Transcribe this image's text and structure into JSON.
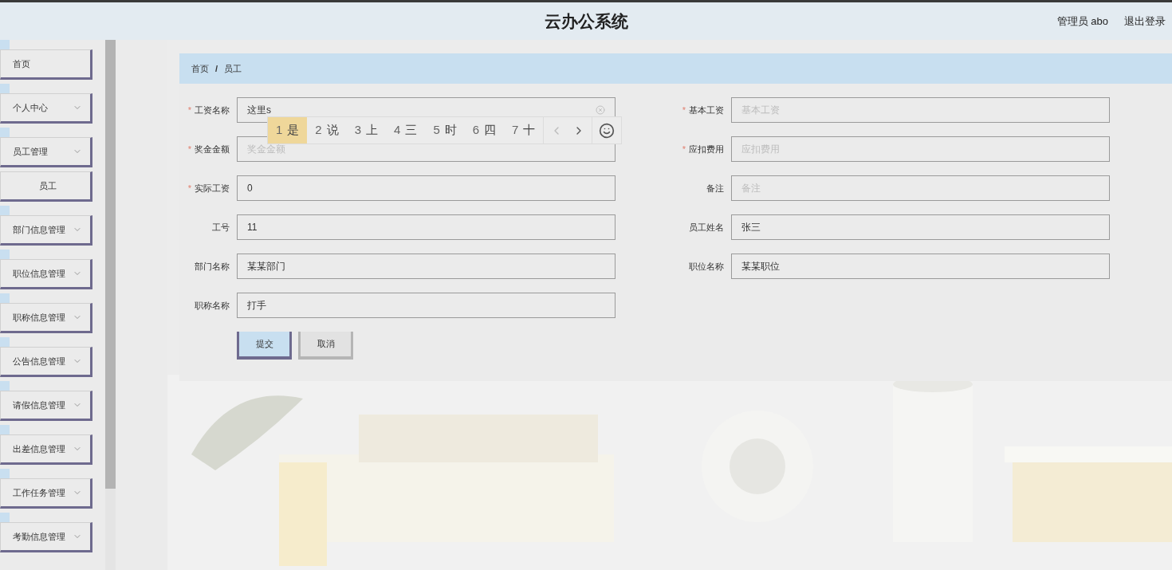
{
  "header": {
    "title": "云办公系统",
    "user": "管理员 abo",
    "logout": "退出登录"
  },
  "sidebar": {
    "items": [
      {
        "label": "首页",
        "kind": "link"
      },
      {
        "label": "个人中心",
        "kind": "menu"
      },
      {
        "label": "员工管理",
        "kind": "menu",
        "children": [
          {
            "label": "员工"
          }
        ]
      },
      {
        "label": "部门信息管理",
        "kind": "menu"
      },
      {
        "label": "职位信息管理",
        "kind": "menu"
      },
      {
        "label": "职称信息管理",
        "kind": "menu"
      },
      {
        "label": "公告信息管理",
        "kind": "menu"
      },
      {
        "label": "请假信息管理",
        "kind": "menu"
      },
      {
        "label": "出差信息管理",
        "kind": "menu"
      },
      {
        "label": "工作任务管理",
        "kind": "menu"
      },
      {
        "label": "考勤信息管理",
        "kind": "menu"
      }
    ]
  },
  "breadcrumb": {
    "items": [
      "首页",
      "员工"
    ],
    "separator": "/"
  },
  "form": {
    "rows": [
      {
        "left": {
          "label": "工资名称",
          "marker": "*",
          "value": "这里s",
          "clearable": true
        },
        "right": {
          "label": "基本工资",
          "marker": "*",
          "placeholder": "基本工资"
        }
      },
      {
        "left": {
          "label": "奖金金额",
          "marker": "*",
          "placeholder": "奖金金额"
        },
        "right": {
          "label": "应扣费用",
          "marker": "*",
          "placeholder": "应扣费用"
        }
      },
      {
        "left": {
          "label": "实际工资",
          "marker": "*",
          "value": "0"
        },
        "right": {
          "label": "备注",
          "placeholder": "备注"
        }
      },
      {
        "left": {
          "label": "工号",
          "value": "11"
        },
        "right": {
          "label": "员工姓名",
          "value": "张三"
        }
      },
      {
        "left": {
          "label": "部门名称",
          "value": "某某部门"
        },
        "right": {
          "label": "职位名称",
          "value": "某某职位"
        }
      },
      {
        "left": {
          "label": "职称名称",
          "value": "打手"
        }
      }
    ],
    "buttons": [
      {
        "label": "提交",
        "kind": "primary"
      },
      {
        "label": "取消",
        "kind": "secondary"
      }
    ]
  },
  "ime": {
    "candidates": [
      {
        "index": "1",
        "text": "是",
        "selected": true
      },
      {
        "index": "2",
        "text": "说",
        "selected": false
      },
      {
        "index": "3",
        "text": "上",
        "selected": false
      },
      {
        "index": "4",
        "text": "三",
        "selected": false
      },
      {
        "index": "5",
        "text": "时",
        "selected": false
      },
      {
        "index": "6",
        "text": "四",
        "selected": false
      },
      {
        "index": "7",
        "text": "十",
        "selected": false
      }
    ]
  }
}
